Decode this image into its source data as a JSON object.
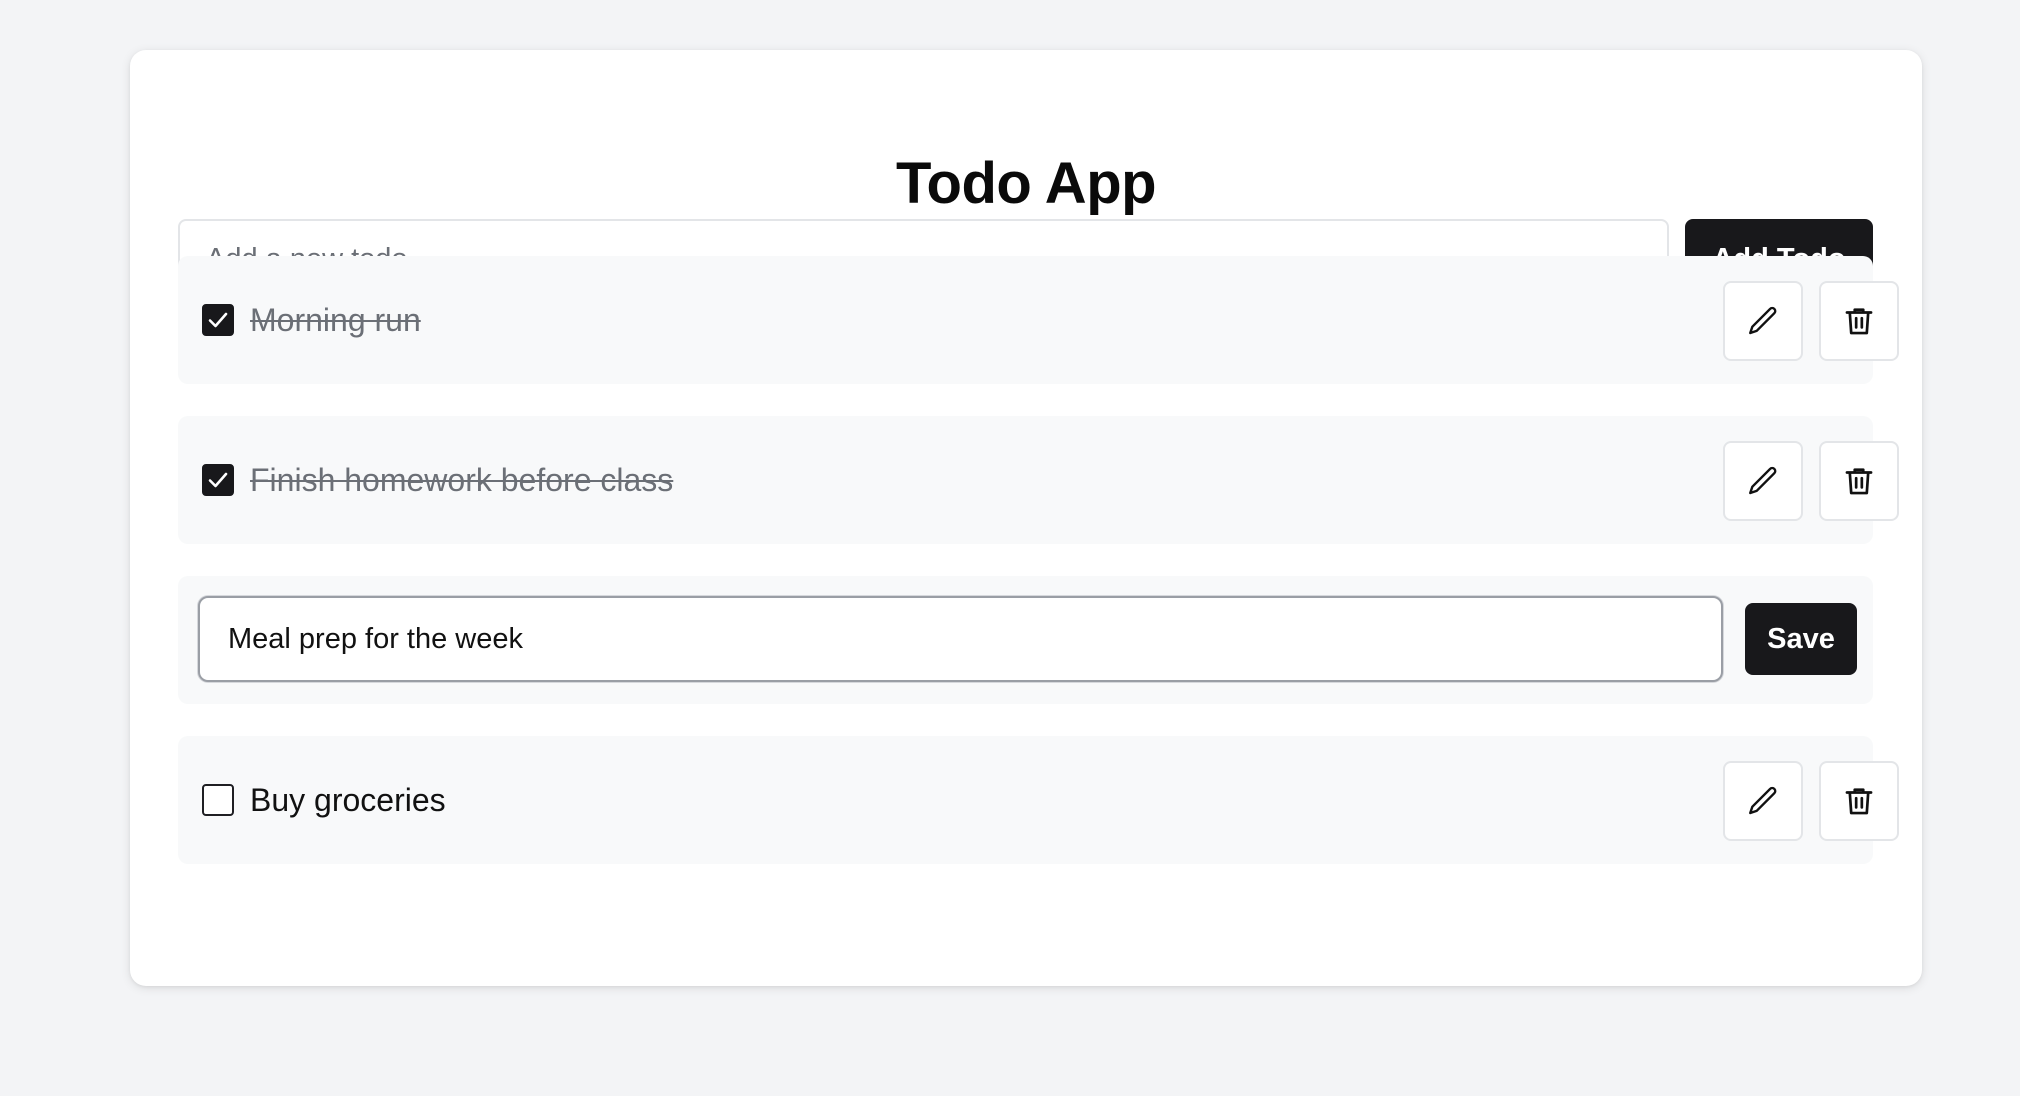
{
  "app": {
    "title": "Todo App"
  },
  "new_todo": {
    "placeholder": "Add a new todo",
    "value": "",
    "add_label": "Add Todo"
  },
  "todos": [
    {
      "text": "Morning run",
      "completed": true,
      "editing": false
    },
    {
      "text": "Finish homework before class",
      "completed": true,
      "editing": false
    },
    {
      "text": "Meal prep for the week",
      "completed": false,
      "editing": true,
      "save_label": "Save"
    },
    {
      "text": "Buy groceries",
      "completed": false,
      "editing": false
    }
  ],
  "icons": {
    "edit": "pencil-icon",
    "delete": "trash-icon",
    "check": "checkmark-icon"
  },
  "colors": {
    "background": "#f3f4f6",
    "card": "#ffffff",
    "row": "#f8f9fa",
    "primary": "#18181b",
    "muted_text": "#6b6f76",
    "border": "#e3e5e8"
  }
}
